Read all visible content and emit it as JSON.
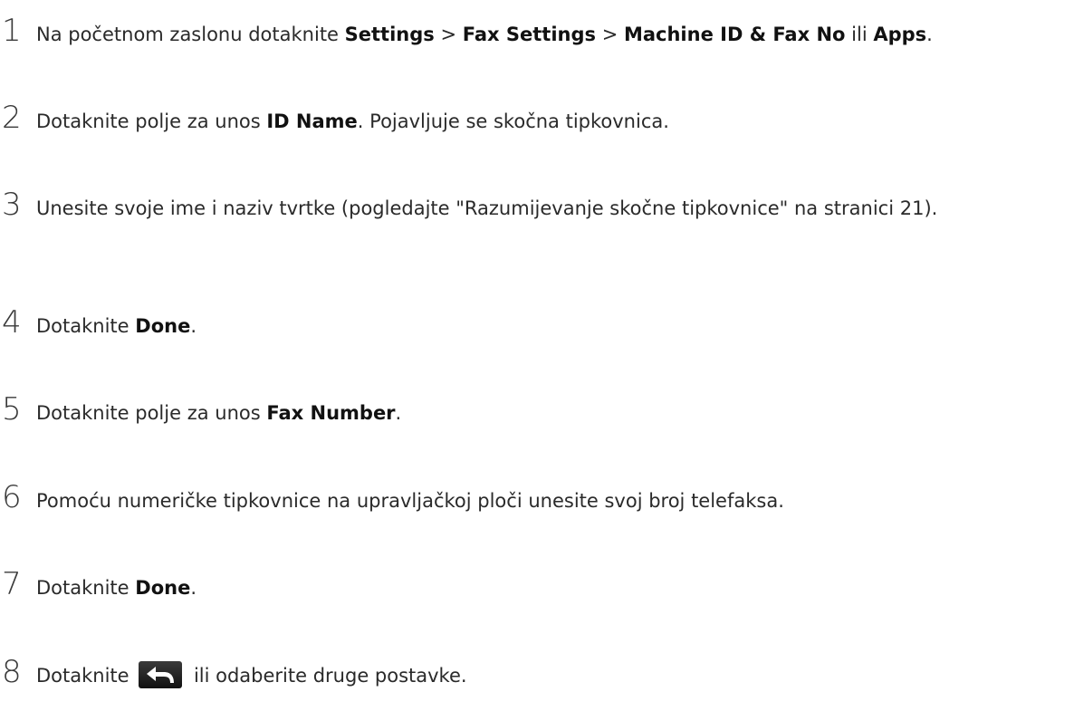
{
  "steps": [
    {
      "number": "1",
      "pre": "Na početnom zaslonu dotaknite ",
      "b1": "Settings",
      "sep1": " > ",
      "b2": "Fax Settings",
      "sep2": " > ",
      "b3": "Machine ID & Fax No",
      "mid": " ili ",
      "b4": "Apps",
      "post": "."
    },
    {
      "number": "2",
      "pre": "Dotaknite polje za unos ",
      "b1": "ID Name",
      "post": ". Pojavljuje se skočna tipkovnica."
    },
    {
      "number": "3",
      "text": "Unesite svoje ime i naziv tvrtke (pogledajte \"Razumijevanje skočne tipkovnice\" na stranici 21)."
    },
    {
      "number": "4",
      "pre": "Dotaknite ",
      "b1": "Done",
      "post": "."
    },
    {
      "number": "5",
      "pre": "Dotaknite polje za unos ",
      "b1": "Fax Number",
      "post": "."
    },
    {
      "number": "6",
      "text": "Pomoću numeričke tipkovnice na upravljačkoj ploči unesite svoj broj telefaksa."
    },
    {
      "number": "7",
      "pre": "Dotaknite ",
      "b1": "Done",
      "post": "."
    },
    {
      "number": "8",
      "pre": "Dotaknite ",
      "icon": "back-arrow-icon",
      "post": " ili odaberite druge postavke."
    }
  ]
}
